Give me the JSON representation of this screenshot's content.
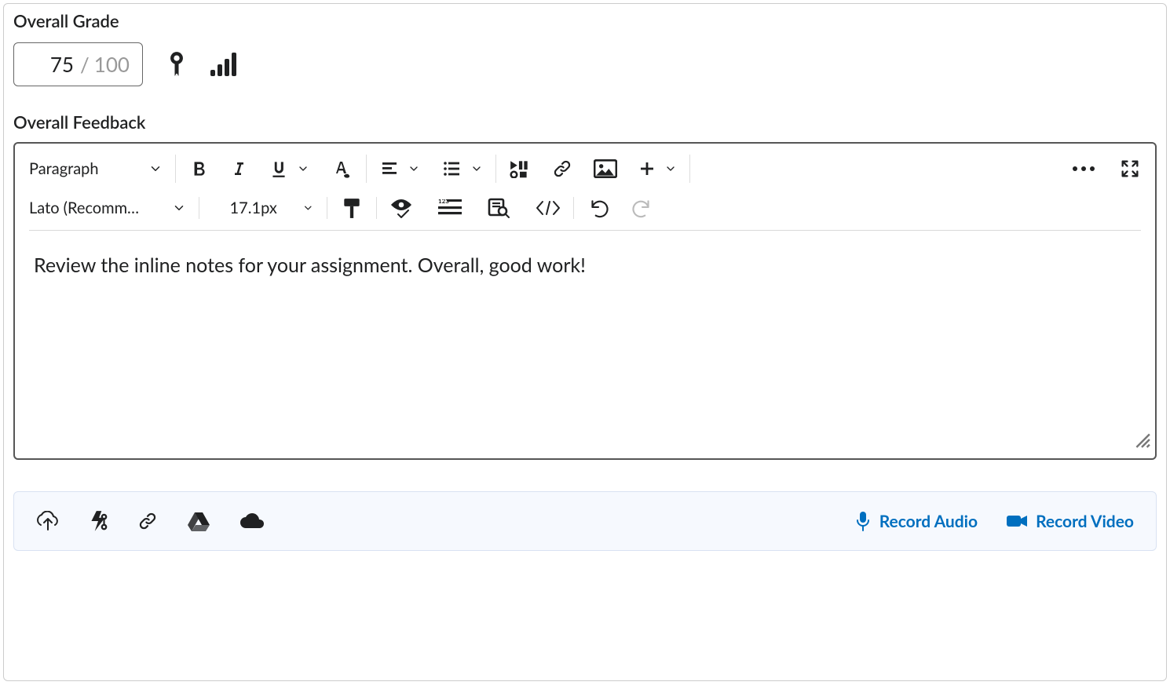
{
  "grade": {
    "label": "Overall Grade",
    "value": "75",
    "separator": "/",
    "max": "100"
  },
  "feedback": {
    "label": "Overall Feedback",
    "content": "Review the inline notes for your assignment. Overall, good work!"
  },
  "toolbar": {
    "format_label": "Paragraph",
    "font_label": "Lato (Recomm…",
    "font_size_label": "17.1px"
  },
  "attachments": {
    "record_audio_label": "Record Audio",
    "record_video_label": "Record Video"
  }
}
